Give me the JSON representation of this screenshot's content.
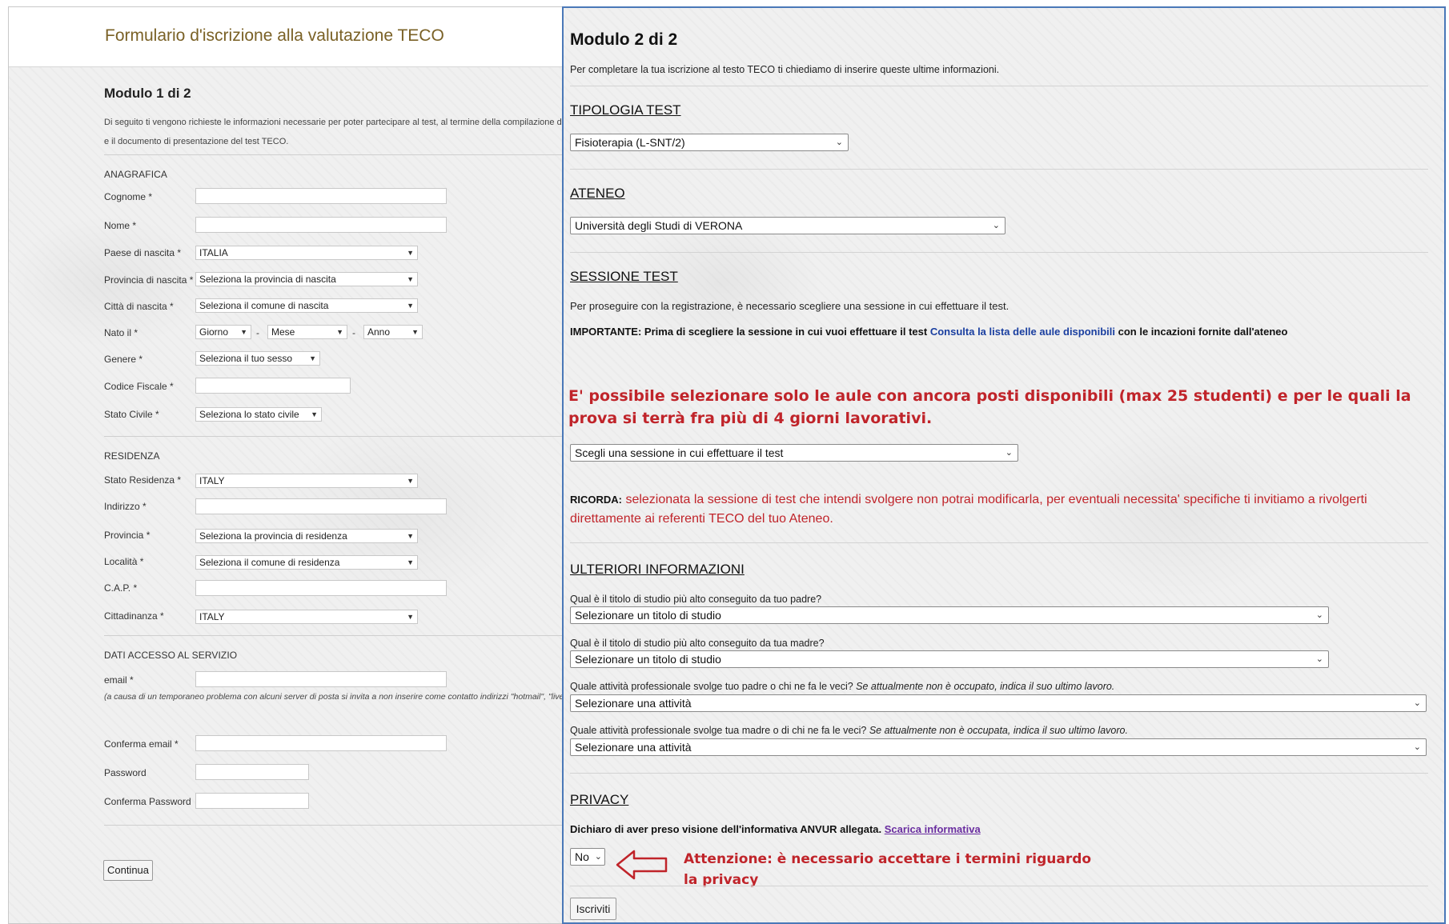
{
  "left": {
    "header_title": "Formulario d'iscrizione alla valutazione TECO",
    "module_title": "Modulo 1 di 2",
    "intro_line1": "Di seguito ti vengono richieste le informazioni necessarie per poter partecipare al test, al termine della compilazione del modu",
    "intro_line2": "e il documento di presentazione del test TECO.",
    "anagrafica": {
      "title": "ANAGRAFICA",
      "cognome_label": "Cognome *",
      "nome_label": "Nome *",
      "paese_label": "Paese di nascita *",
      "paese_value": "ITALIA",
      "provincia_label": "Provincia di nascita *",
      "provincia_value": "Seleziona la provincia di nascita",
      "citta_label": "Città di nascita *",
      "citta_value": "Seleziona il comune di nascita",
      "nato_label": "Nato il *",
      "giorno": "Giorno",
      "mese": "Mese",
      "anno": "Anno",
      "sep": "-",
      "genere_label": "Genere *",
      "genere_value": "Seleziona il tuo sesso",
      "cf_label": "Codice Fiscale *",
      "stato_civile_label": "Stato Civile *",
      "stato_civile_value": "Seleziona lo stato civile"
    },
    "residenza": {
      "title": "RESIDENZA",
      "stato_label": "Stato Residenza *",
      "stato_value": "ITALY",
      "indirizzo_label": "Indirizzo *",
      "provincia_label": "Provincia *",
      "provincia_value": "Seleziona la provincia di residenza",
      "localita_label": "Località *",
      "localita_value": "Seleziona il comune di residenza",
      "cap_label": "C.A.P. *",
      "cittadinanza_label": "Cittadinanza *",
      "cittadinanza_value": "ITALY"
    },
    "accesso": {
      "title": "DATI ACCESSO AL SERVIZIO",
      "email_label": "email *",
      "email_note": "(a causa di un temporaneo problema con alcuni server di posta si invita a non inserire come contatto indirizzi \"hotmail\", \"live\",",
      "conferma_email_label": "Conferma email *",
      "password_label": "Password",
      "conferma_password_label": "Conferma Password"
    },
    "continua_button": "Continua"
  },
  "right": {
    "module_title": "Modulo 2 di 2",
    "intro": "Per completare la tua iscrizione al testo TECO ti chiediamo di inserire queste ultime informazioni.",
    "tipologia": {
      "title": "TIPOLOGIA TEST",
      "value": "Fisioterapia (L-SNT/2)"
    },
    "ateneo": {
      "title": "ATENEO",
      "value": "Università degli Studi di VERONA"
    },
    "sessione": {
      "title": "SESSIONE TEST",
      "text": "Per proseguire con la registrazione, è necessario scegliere una sessione in cui effettuare il test.",
      "importante_bold": "IMPORTANTE:",
      "importante_text": " Prima di scegliere la sessione in cui vuoi effettuare il test ",
      "importante_link": "Consulta la lista delle aule disponibili",
      "importante_tail": " con le incazioni fornite dall'ateneo",
      "red_note_line1": "E' possibile selezionare solo le aule con ancora posti disponibili (max 25 studenti) e per le quali la",
      "red_note_line2": "prova si terrà fra più di 4 giorni lavorativi.",
      "select_value": "Scegli una sessione in cui effettuare il test",
      "ricorda_bold": "RICORDA:",
      "ricorda_line1": " selezionata la sessione di test che intendi svolgere non potrai modificarla, per eventuali necessita' specifiche ti invitiamo a rivolgerti",
      "ricorda_line2": "direttamente ai referenti TECO del tuo Ateneo."
    },
    "ulteriori": {
      "title": "ULTERIORI INFORMAZIONI",
      "q1": "Qual è il titolo di studio più alto conseguito da tuo padre?",
      "q1_value": "Selezionare un titolo di studio",
      "q2": "Qual è il titolo di studio più alto conseguito da tua madre?",
      "q2_value": "Selezionare un titolo di studio",
      "q3": "Quale attività professionale svolge tuo padre o chi ne fa le veci? ",
      "q3_italic": "Se attualmente non è occupato, indica il suo ultimo lavoro.",
      "q3_value": "Selezionare una attività",
      "q4": "Quale attività professionale svolge tua madre o di chi ne fa le veci? ",
      "q4_italic": "Se attualmente non è occupata, indica il suo ultimo lavoro.",
      "q4_value": "Selezionare una attività"
    },
    "privacy": {
      "title": "PRIVACY",
      "text": "Dichiaro di aver preso visione dell'informativa ANVUR allegata. ",
      "link": "Scarica informativa",
      "select_value": "No",
      "warning_line1": "Attenzione: è necessario accettare i termini riguardo",
      "warning_line2": "la privacy"
    },
    "iscriviti_button": "Iscriviti"
  },
  "colors": {
    "header_title": "#7a6126",
    "accent_red": "#c0242a",
    "link_blue": "#1a3fa0",
    "frame_blue": "#4a78b8"
  }
}
